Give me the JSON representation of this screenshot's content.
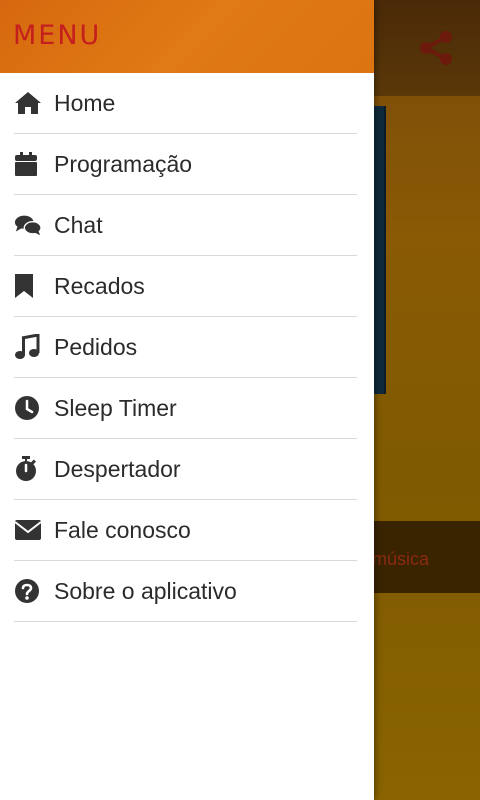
{
  "drawer": {
    "title": "MENU",
    "items": [
      {
        "label": "Home",
        "icon": "home-icon"
      },
      {
        "label": "Programação",
        "icon": "calendar-icon"
      },
      {
        "label": "Chat",
        "icon": "chat-icon"
      },
      {
        "label": "Recados",
        "icon": "bookmark-icon"
      },
      {
        "label": "Pedidos",
        "icon": "music-note-icon"
      },
      {
        "label": "Sleep Timer",
        "icon": "clock-icon"
      },
      {
        "label": "Despertador",
        "icon": "stopwatch-icon"
      },
      {
        "label": "Fale conosco",
        "icon": "envelope-icon"
      },
      {
        "label": "Sobre o aplicativo",
        "icon": "question-circle-icon"
      }
    ]
  },
  "background": {
    "song_text": "música",
    "share_icon": "share-icon"
  },
  "colors": {
    "drawer_header": "#dc7412",
    "title_color": "#c41e1e",
    "item_text": "#2b2b2b",
    "icon_color": "#333333"
  }
}
